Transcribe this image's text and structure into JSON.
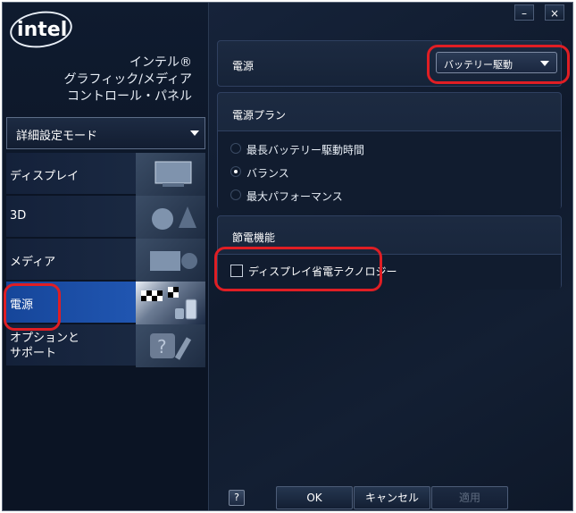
{
  "brand": {
    "logo_text": "intel",
    "line1": "インテル®",
    "line2": "グラフィック/メディア",
    "line3": "コントロール・パネル"
  },
  "mode_select": {
    "value": "詳細設定モード"
  },
  "nav": {
    "items": [
      {
        "label": "ディスプレイ",
        "icon": "display-icon"
      },
      {
        "label": "3D",
        "icon": "3d-shapes-icon"
      },
      {
        "label": "メディア",
        "icon": "media-camera-icon"
      },
      {
        "label": "電源",
        "icon": "power-flag-battery-icon",
        "active": true
      },
      {
        "label_line1": "オプションと",
        "label_line2": "サポート",
        "icon": "support-tools-icon"
      }
    ]
  },
  "window_controls": {
    "minimize": "–",
    "close": "×"
  },
  "power_source": {
    "label": "電源",
    "value": "バッテリー駆動"
  },
  "power_plan": {
    "title": "電源プラン",
    "options": [
      {
        "label": "最長バッテリー駆動時間",
        "selected": false
      },
      {
        "label": "バランス",
        "selected": true
      },
      {
        "label": "最大パフォーマンス",
        "selected": false
      }
    ]
  },
  "power_saving": {
    "title": "節電機能",
    "checkbox_label": "ディスプレイ省電テクノロジー",
    "checked": false
  },
  "footer": {
    "help": "?",
    "ok": "OK",
    "cancel": "キャンセル",
    "apply": "適用"
  },
  "colors": {
    "highlight_ring": "#e01e24",
    "active_nav": "#2157b3",
    "background": "#0b1424"
  }
}
